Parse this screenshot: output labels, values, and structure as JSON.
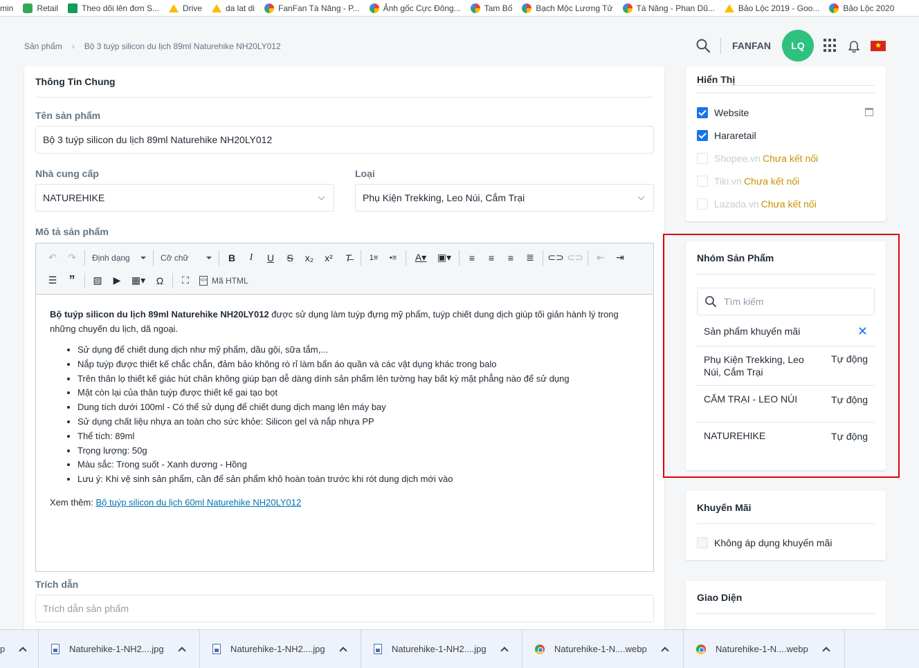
{
  "bookmarks": [
    {
      "label": "min",
      "icon": "none"
    },
    {
      "label": "Retail",
      "icon": "green-app-icon"
    },
    {
      "label": "Theo dõi lên đơn S...",
      "icon": "sheets-icon"
    },
    {
      "label": "Drive",
      "icon": "drive-icon"
    },
    {
      "label": "da lat di",
      "icon": "drive-icon"
    },
    {
      "label": "FanFan Tà Năng - P...",
      "icon": "photos-icon"
    },
    {
      "label": "Ảnh gốc Cực Đông...",
      "icon": "photos-icon"
    },
    {
      "label": "Tam Bố",
      "icon": "photos-icon"
    },
    {
      "label": "Bạch Mộc Lương Tử",
      "icon": "photos-icon"
    },
    {
      "label": "Tà Năng - Phan Dũ...",
      "icon": "photos-icon"
    },
    {
      "label": "Bảo Lộc 2019 - Goo...",
      "icon": "drive-icon"
    },
    {
      "label": "Bảo Lộc 2020",
      "icon": "photos-icon"
    }
  ],
  "breadcrumb": {
    "root": "Sản phẩm",
    "current": "Bộ 3 tuýp silicon du lịch 89ml Naturehike NH20LY012"
  },
  "header": {
    "store": "FANFAN",
    "avatar": "LQ"
  },
  "general": {
    "title": "Thông Tin Chung",
    "name_label": "Tên sản phẩm",
    "name_value": "Bộ 3 tuýp silicon du lịch 89ml Naturehike NH20LY012",
    "supplier_label": "Nhà cung cấp",
    "supplier_value": "NATUREHIKE",
    "type_label": "Loại",
    "type_value": "Phụ Kiện Trekking, Leo Núi, Cắm Trại",
    "desc_label": "Mô tả sản phẩm",
    "excerpt_label": "Trích dẫn",
    "excerpt_placeholder": "Trích dẫn sản phẩm"
  },
  "editor": {
    "format_label": "Định dạng",
    "fontsize_label": "Cỡ chữ",
    "html_label": "Mã HTML",
    "intro_bold": "Bộ tuýp silicon du lịch 89ml Naturehike NH20LY012",
    "intro_rest": " được sử dụng làm tuýp đựng mỹ phẩm, tuýp chiết dung dịch giúp tối giản hành lý trong những chuyến du lịch, dã ngoại.",
    "bullets": [
      "Sử dụng để chiết dung dịch như mỹ phẩm, dầu gội, sữa tắm,...",
      "Nắp tuýp được thiết kế chắc chắn, đảm bảo không rò rỉ làm bẩn áo quần và các vật dụng khác trong balo",
      "Trên thân lọ thiết kế giác hút chân không giúp bạn dễ dàng dính sản phẩm lên tường hay bất kỳ mặt phẳng nào để sử dụng",
      "Mặt còn lại của thân tuýp được thiết kế gai tạo bọt",
      "Dung tích dưới 100ml - Có thể sử dụng để chiết dung dịch mang lên máy bay",
      "Sử dụng chất liệu nhựa an toàn cho sức khỏe: Silicon gel và nắp nhựa PP",
      "Thể tích: 89ml",
      "Trọng lượng: 50g",
      "Màu sắc: Trong suốt - Xanh dương - Hồng",
      "Lưu ý: Khi vệ sinh sản phẩm, cần để sản phẩm khô hoàn toàn trước khi rót dung dịch mới vào"
    ],
    "see_more": "Xem thêm: ",
    "see_more_link": "Bộ tuýp silicon du lịch 60ml Naturehike NH20LY012 "
  },
  "display": {
    "title": "Hiển Thị",
    "channels": [
      {
        "name": "Website",
        "checked": true,
        "note": ""
      },
      {
        "name": "Hararetail",
        "checked": true,
        "note": ""
      },
      {
        "name": "Shopee.vn",
        "checked": false,
        "note": "Chưa kết nối"
      },
      {
        "name": "Tiki.vn",
        "checked": false,
        "note": "Chưa kết nối"
      },
      {
        "name": "Lazada.vn",
        "checked": false,
        "note": "Chưa kết nối"
      }
    ]
  },
  "groups": {
    "title": "Nhóm Sản Phẩm",
    "search_placeholder": "Tìm kiếm",
    "items": [
      {
        "name": "Sản phẩm khuyến mãi",
        "status": ""
      },
      {
        "name": "Phụ Kiện Trekking, Leo Núi, Cắm Trại",
        "status": "Tự động"
      },
      {
        "name": "CẮM TRẠI - LEO NÚI",
        "status": "Tự động"
      },
      {
        "name": "NATUREHIKE",
        "status": "Tự động"
      }
    ]
  },
  "promo": {
    "title": "Khuyến Mãi",
    "option": "Không áp dụng khuyến mãi"
  },
  "theme": {
    "title": "Giao Diện"
  },
  "downloads": [
    {
      "name": "p",
      "kind": "none"
    },
    {
      "name": "Naturehike-1-NH2....jpg",
      "kind": "file"
    },
    {
      "name": "Naturehike-1-NH2....jpg",
      "kind": "file"
    },
    {
      "name": "Naturehike-1-NH2....jpg",
      "kind": "file"
    },
    {
      "name": "Naturehike-1-N....webp",
      "kind": "chrome"
    },
    {
      "name": "Naturehike-1-N....webp",
      "kind": "chrome"
    }
  ],
  "colors": {
    "accent": "#1a73e8",
    "avatar": "#2ec27e",
    "highlight_box": "#e00000",
    "warning": "#c79100"
  }
}
